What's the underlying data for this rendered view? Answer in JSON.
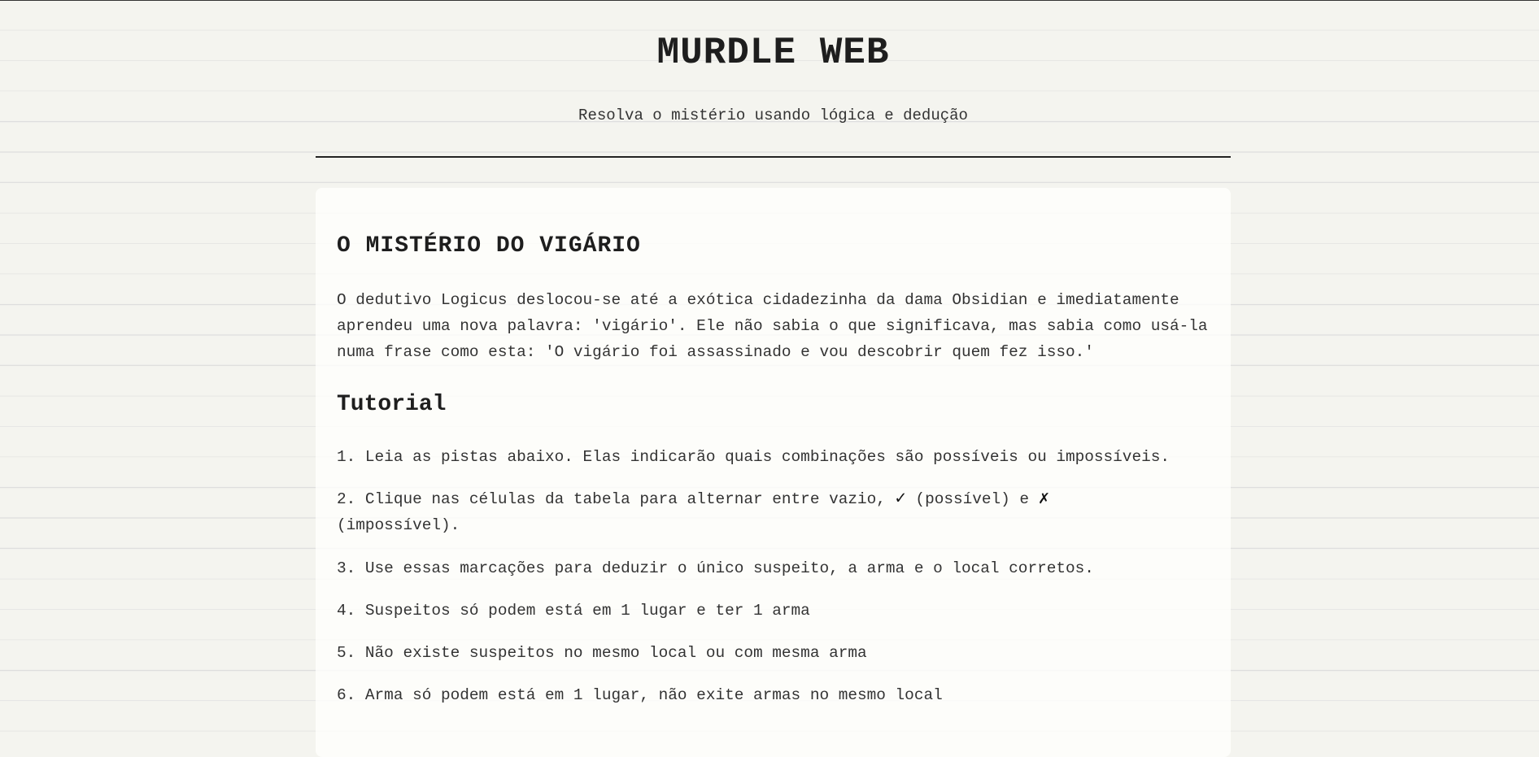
{
  "header": {
    "title": "MURDLE WEB",
    "subtitle": "Resolva o mistério usando lógica e dedução"
  },
  "mystery": {
    "title": "O MISTÉRIO DO VIGÁRIO",
    "intro": "O dedutivo Logicus deslocou-se até a exótica cidadezinha da dama Obsidian e imediatamente aprendeu uma nova palavra: 'vigário'. Ele não sabia o que significava, mas sabia como usá-la numa frase como esta: 'O vigário foi assassinado e vou descobrir quem fez isso.'"
  },
  "tutorial": {
    "title": "Tutorial",
    "step1": "1. Leia as pistas abaixo. Elas indicarão quais combinações são possíveis ou impossíveis.",
    "step2_part1": "2. Clique nas células da tabela para alternar entre vazio, ",
    "step2_check": "✓",
    "step2_part2": " (possível) e ",
    "step2_cross": "✗",
    "step2_part3": " (impossível).",
    "step3": "3. Use essas marcações para deduzir o único suspeito, a arma e o local corretos.",
    "step4": "4. Suspeitos só podem está em 1 lugar e ter 1 arma",
    "step5": "5. Não existe suspeitos no mesmo local ou com mesma arma",
    "step6": "6. Arma só podem está em 1 lugar, não exite armas no mesmo local"
  }
}
